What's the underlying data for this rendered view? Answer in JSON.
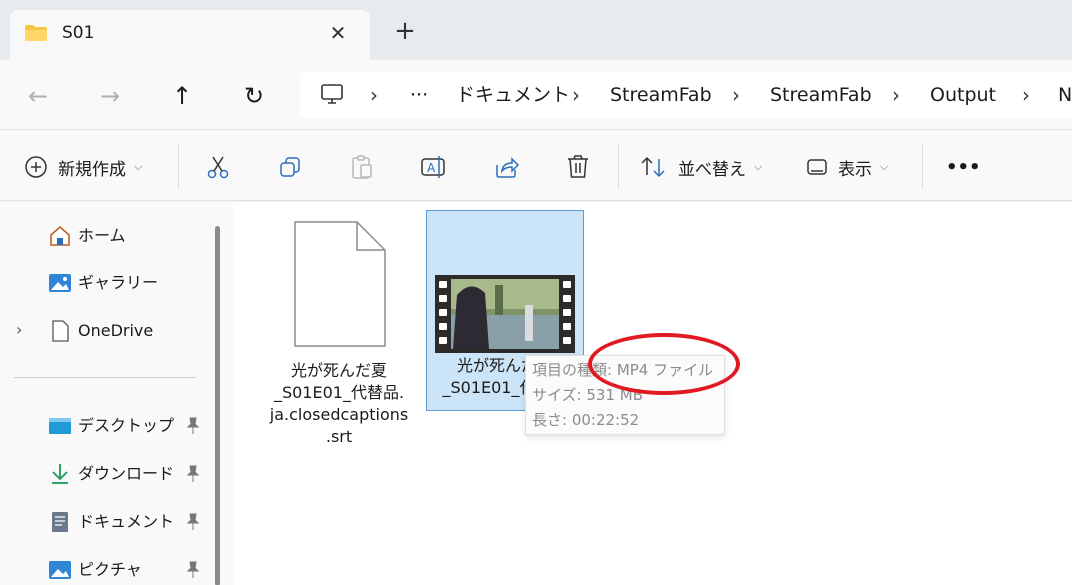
{
  "tab": {
    "title": "S01",
    "close_icon": "close-icon",
    "new_icon": "plus-icon"
  },
  "nav": {
    "back_icon": "arrow-left-icon",
    "forward_icon": "arrow-right-icon",
    "up_icon": "arrow-up-icon",
    "refresh_icon": "refresh-icon"
  },
  "address": {
    "root_icon": "computer-icon",
    "overflow": "···",
    "crumbs": [
      "ドキュメント",
      "StreamFab",
      "StreamFab",
      "Output",
      "N"
    ]
  },
  "toolbar": {
    "new_label": "新規作成",
    "sort_label": "並べ替え",
    "view_label": "表示",
    "more_label": "•••"
  },
  "sidebar": {
    "items": [
      {
        "label": "ホーム",
        "icon": "home-icon"
      },
      {
        "label": "ギャラリー",
        "icon": "gallery-icon"
      },
      {
        "label": "OneDrive",
        "icon": "document-icon"
      },
      {
        "label": "デスクトップ",
        "icon": "desktop-icon"
      },
      {
        "label": "ダウンロード",
        "icon": "download-icon"
      },
      {
        "label": "ドキュメント",
        "icon": "documents-icon"
      },
      {
        "label": "ピクチャ",
        "icon": "pictures-icon"
      }
    ]
  },
  "files": [
    {
      "name_lines": [
        "光が死んだ夏",
        "_S01E01_代替品.",
        "ja.closedcaptions",
        ".srt"
      ],
      "icon": "blank-file-icon"
    },
    {
      "name_lines": [
        "光が死んだ夏",
        "_S01E01_代替品"
      ],
      "icon": "video-thumbnail-icon"
    }
  ],
  "tooltip": {
    "type_line": "項目の種類: MP4 ファイル",
    "size_line": "サイズ: 531 MB",
    "length_line": "長さ: 00:22:52"
  },
  "colors": {
    "annotation": "#e01a22",
    "selection": "#cce4f7",
    "accent": "#0067c0"
  }
}
